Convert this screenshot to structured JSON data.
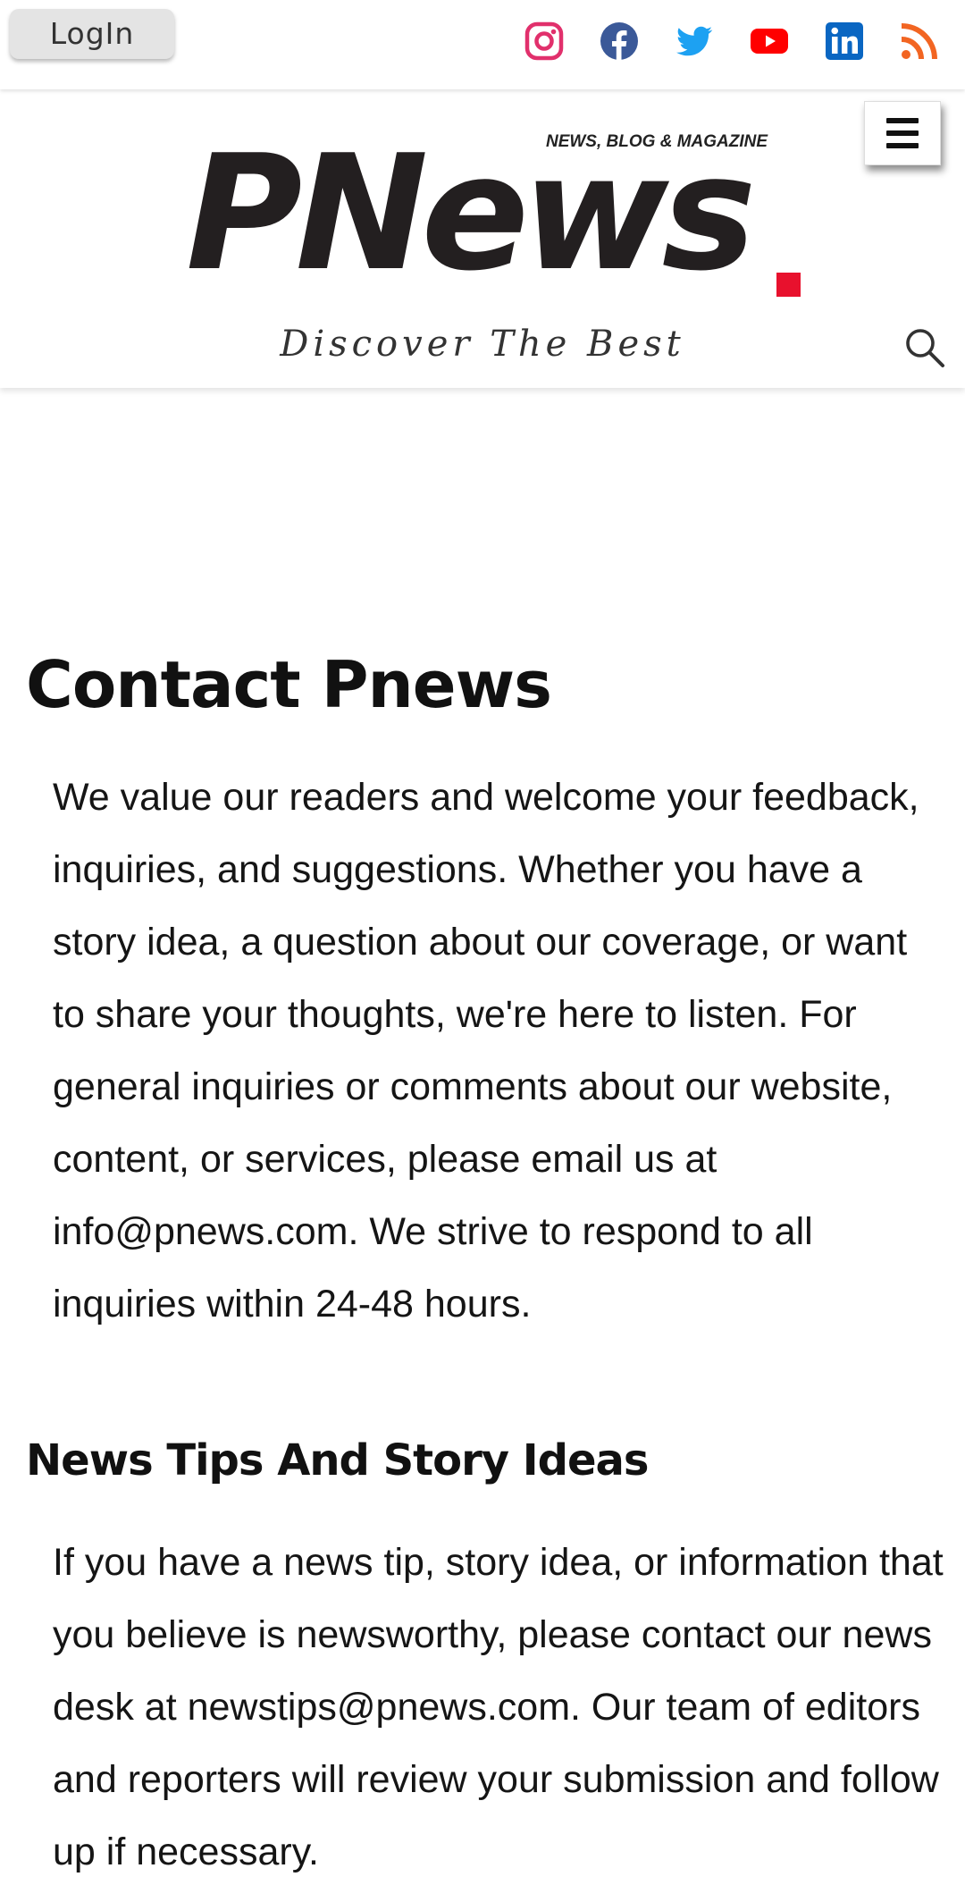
{
  "topbar": {
    "login_label": "LogIn",
    "social": [
      {
        "name": "instagram-icon",
        "color": "#e1306c"
      },
      {
        "name": "facebook-icon",
        "color": "#3b5998"
      },
      {
        "name": "twitter-icon",
        "color": "#1da1f2"
      },
      {
        "name": "youtube-icon",
        "color": "#ff0000"
      },
      {
        "name": "linkedin-icon",
        "color": "#0a66c2"
      },
      {
        "name": "rss-icon",
        "color": "#f26522"
      }
    ]
  },
  "header": {
    "tagline_small": "NEWS, BLOG & MAGAZINE",
    "brand_name": "PNews",
    "brand_dot_color": "#e8112d",
    "slogan": "Discover The Best",
    "menu_icon": "hamburger-icon",
    "search_icon": "search-icon"
  },
  "main": {
    "title": "Contact Pnews",
    "intro": "We value our readers and welcome your feedback, inquiries, and suggestions. Whether you have a story idea, a question about our coverage, or want to share your thoughts, we're here to listen. For general inquiries or comments about our website, content, or services, please email us at info@pnews.com. We strive to respond to all inquiries within 24-48 hours.",
    "section_title": "News Tips And Story Ideas",
    "section_body": "If you have a news tip, story idea, or information that you believe is newsworthy, please contact our news desk at newstips@pnews.com. Our team of editors and reporters will review your submission and follow up if necessary."
  }
}
